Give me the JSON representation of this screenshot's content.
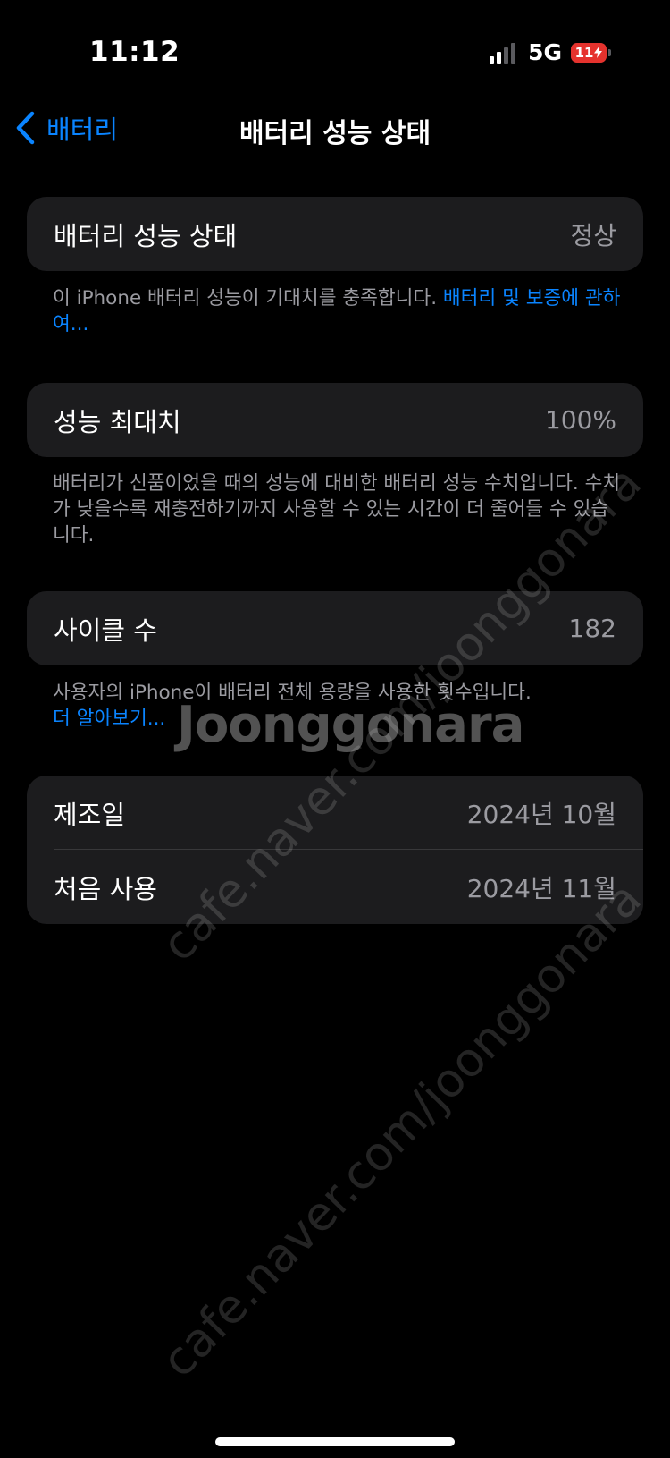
{
  "status_bar": {
    "time": "11:12",
    "network": "5G",
    "battery_level": "11"
  },
  "nav": {
    "back_label": "배터리",
    "title": "배터리 성능 상태"
  },
  "health_card": {
    "label": "배터리 성능 상태",
    "value": "정상"
  },
  "health_note": {
    "text": "이 iPhone 배터리 성능이 기대치를 충족합니다. ",
    "link": "배터리 및 보증에 관하여..."
  },
  "capacity_card": {
    "label": "성능 최대치",
    "value": "100%"
  },
  "capacity_note": {
    "text": "배터리가 신품이었을 때의 성능에 대비한 배터리 성능 수치입니다. 수치가 낮을수록 재충전하기까지 사용할 수 있는 시간이 더 줄어들 수 있습니다."
  },
  "cycle_card": {
    "label": "사이클 수",
    "value": "182"
  },
  "cycle_note": {
    "text": "사용자의 iPhone이 배터리 전체 용량을 사용한 횟수입니다.",
    "link": "더 알아보기..."
  },
  "dates_card": {
    "manufactured_label": "제조일",
    "manufactured_value": "2024년 10월",
    "first_use_label": "처음 사용",
    "first_use_value": "2024년 11월"
  },
  "watermark": {
    "url": "cafe.naver.com/joonggonara",
    "logo": "Joonggonara"
  },
  "colors": {
    "background": "#000000",
    "card": "#1c1c1e",
    "accent": "#0a84ff",
    "secondary_text": "#9b9ba1",
    "battery_low": "#e5322d"
  }
}
